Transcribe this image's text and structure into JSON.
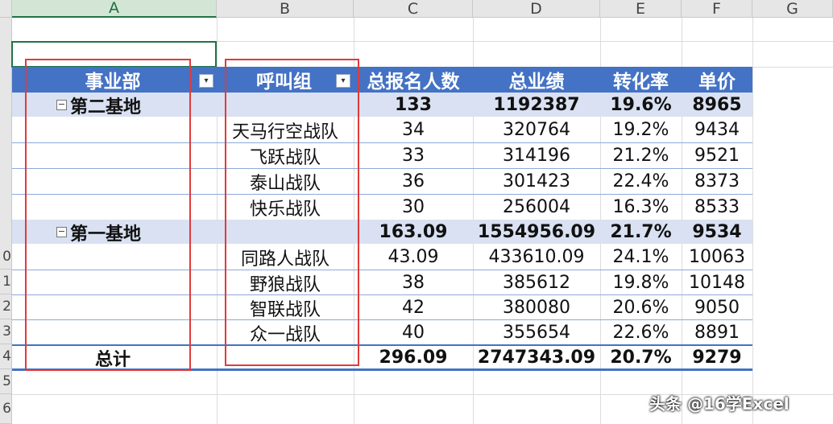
{
  "columns": [
    "A",
    "B",
    "C",
    "D",
    "E",
    "F",
    "G"
  ],
  "rows": [
    "0",
    "1",
    "2",
    "3",
    "4",
    "5",
    "6"
  ],
  "pivot": {
    "headers": [
      "事业部",
      "呼叫组",
      "总报名人数",
      "总业绩",
      "转化率",
      "单价"
    ],
    "groups": [
      {
        "name": "第二基地",
        "total": {
          "count": "133",
          "perf": "1192387",
          "rate": "19.6%",
          "price": "8965"
        },
        "items": [
          {
            "name": "天马行空战队",
            "count": "34",
            "perf": "320764",
            "rate": "19.2%",
            "price": "9434"
          },
          {
            "name": "飞跃战队",
            "count": "33",
            "perf": "314196",
            "rate": "21.2%",
            "price": "9521"
          },
          {
            "name": "泰山战队",
            "count": "36",
            "perf": "301423",
            "rate": "22.4%",
            "price": "8373"
          },
          {
            "name": "快乐战队",
            "count": "30",
            "perf": "256004",
            "rate": "16.3%",
            "price": "8533"
          }
        ]
      },
      {
        "name": "第一基地",
        "total": {
          "count": "163.09",
          "perf": "1554956.09",
          "rate": "21.7%",
          "price": "9534"
        },
        "items": [
          {
            "name": "同路人战队",
            "count": "43.09",
            "perf": "433610.09",
            "rate": "24.1%",
            "price": "10063"
          },
          {
            "name": "野狼战队",
            "count": "38",
            "perf": "385612",
            "rate": "19.8%",
            "price": "10148"
          },
          {
            "name": "智联战队",
            "count": "42",
            "perf": "380080",
            "rate": "20.6%",
            "price": "9050"
          },
          {
            "name": "众一战队",
            "count": "40",
            "perf": "355654",
            "rate": "22.6%",
            "price": "8891"
          }
        ]
      }
    ],
    "grand_total": {
      "label": "总计",
      "count": "296.09",
      "perf": "2747343.09",
      "rate": "20.7%",
      "price": "9279"
    }
  },
  "collapse_glyph": "−",
  "filter_glyph": "▾",
  "watermark": "头条 @16学Excel",
  "colors": {
    "header": "#4472c4",
    "subtotal": "#d9e1f2",
    "highlight": "#e03b3b"
  }
}
